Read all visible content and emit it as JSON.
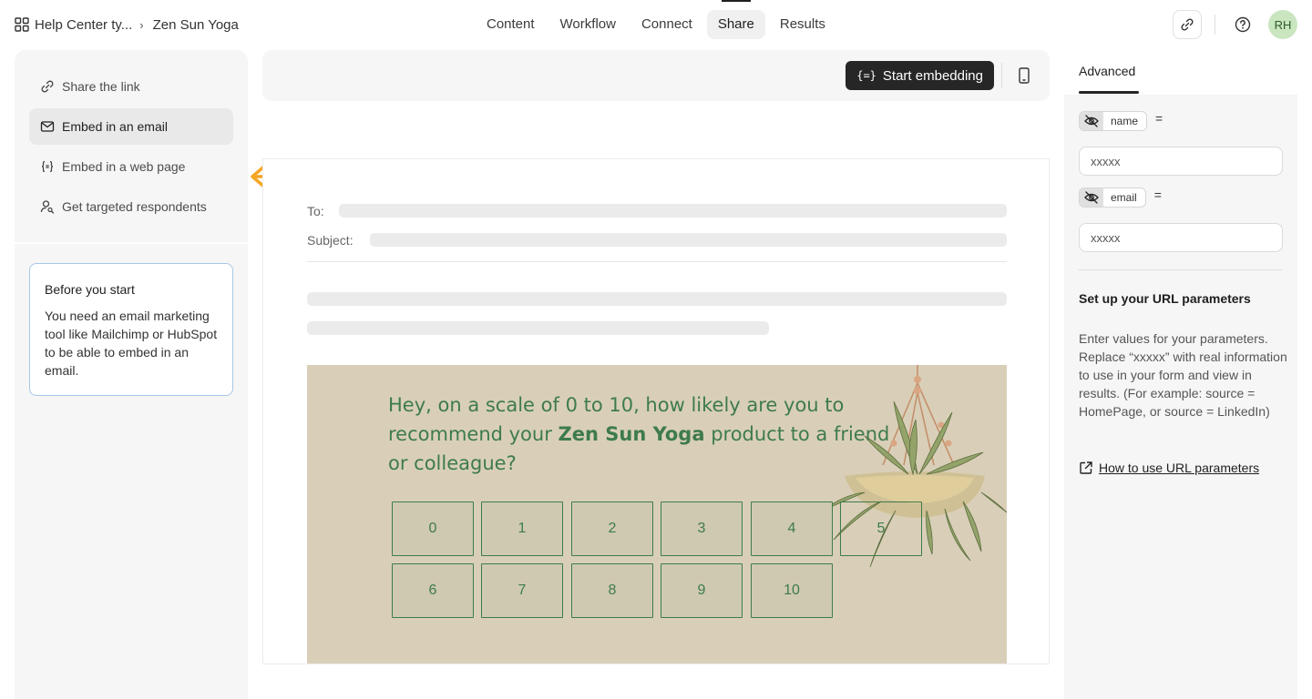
{
  "breadcrumb": {
    "workspace": "Help Center ty...",
    "separator": "›",
    "form": "Zen Sun Yoga"
  },
  "nav": {
    "tabs": [
      "Content",
      "Workflow",
      "Connect",
      "Share",
      "Results"
    ],
    "active": "Share"
  },
  "user": {
    "initials": "RH"
  },
  "share_menu": {
    "items": [
      {
        "label": "Share the link",
        "icon": "link-icon"
      },
      {
        "label": "Embed in an email",
        "icon": "envelope-icon",
        "active": true
      },
      {
        "label": "Embed in a web page",
        "icon": "code-braces-icon"
      },
      {
        "label": "Get targeted respondents",
        "icon": "person-search-icon"
      }
    ]
  },
  "note": {
    "title": "Before you start",
    "body": "You need an email marketing tool like Mailchimp or HubSpot to be able to embed in an email."
  },
  "toolbar": {
    "embed_label": "Start embedding",
    "embed_icon": "{=}"
  },
  "email_preview": {
    "to_label": "To:",
    "subject_label": "Subject:",
    "question_pre": "Hey, on a scale of 0 to 10, how likely are you to recommend your ",
    "question_brand": "Zen Sun Yoga",
    "question_post": " product to a friend or colleague?",
    "scores": [
      "0",
      "1",
      "2",
      "3",
      "4",
      "5",
      "6",
      "7",
      "8",
      "9",
      "10"
    ]
  },
  "advanced": {
    "tab_label": "Advanced",
    "params": [
      {
        "name": "name",
        "value": "xxxxx"
      },
      {
        "name": "email",
        "value": "xxxxx"
      }
    ],
    "equals": "=",
    "title": "Set up your URL parameters",
    "body": "Enter values for your parameters. Replace “xxxxx” with real information to use in your form and view in results. (For example: source = HomePage, or source = LinkedIn)",
    "link_label": "How to use URL parameters"
  },
  "colors": {
    "accent_dark": "#262627",
    "banner_bg": "#d9cfb8",
    "banner_green": "#3e7b4c",
    "arrow_orange": "#f5a623",
    "avatar_bg": "#c9e6c1"
  }
}
